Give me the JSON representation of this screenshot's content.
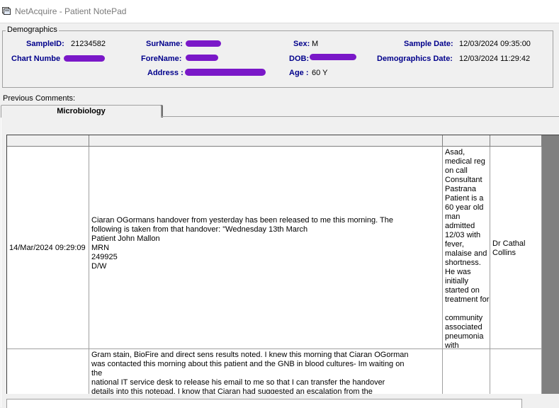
{
  "window": {
    "title": "NetAcquire - Patient NotePad"
  },
  "demographics": {
    "group_label": "Demographics",
    "sample_id_label": "SampleID:",
    "sample_id": "21234582",
    "chart_number_label": "Chart Numbe",
    "surname_label": "SurName:",
    "forename_label": "ForeName:",
    "address_label": "Address :",
    "sex_label": "Sex:",
    "sex": "M",
    "dob_label": "DOB:",
    "age_label": "Age :",
    "age": "60 Y",
    "sample_date_label": "Sample Date:",
    "sample_date": "12/03/2024 09:35:00",
    "demographics_date_label": "Demographics Date:",
    "demographics_date": "12/03/2024 11:29:42"
  },
  "comments": {
    "previous_label": "Previous Comments:",
    "tabs": [
      {
        "label": "Microbiology"
      }
    ],
    "rows": [
      {
        "datetime": "14/Mar/2024 09:29:09",
        "comment": "Ciaran OGormans handover from yesterday has been released to me this morning. The\nfollowing is taken from that handover: \"Wednesday 13th March\nPatient John Mallon\nMRN\n249925\nD/W",
        "note": "Asad,\nmedical reg\non call\nConsultant\nPastrana\nPatient is a\n60 year old\nman\nadmitted\n12/03 with\nfever,\nmalaise and\nshortness.\nHe was\ninitially\nstarted on\ntreatment for\n\ncommunity\nassociated\npneumonia\nwith",
        "author": "Dr Cathal\nCollins"
      },
      {
        "datetime": "",
        "comment": "Gram stain, BioFire and direct sens results noted. I knew this morning that Ciaran OGorman\nwas contacted this morning about this patient and the GNB in blood cultures- Im waiting on\nthe\nnational IT service desk to release his email to me so that I can transfer the handover\ndetails into this notepad. I know that Ciaran had suggested an escalation from the",
        "note": "",
        "author": ""
      }
    ]
  },
  "colors": {
    "label_blue": "#00008b",
    "redaction": "#7a18c8"
  }
}
